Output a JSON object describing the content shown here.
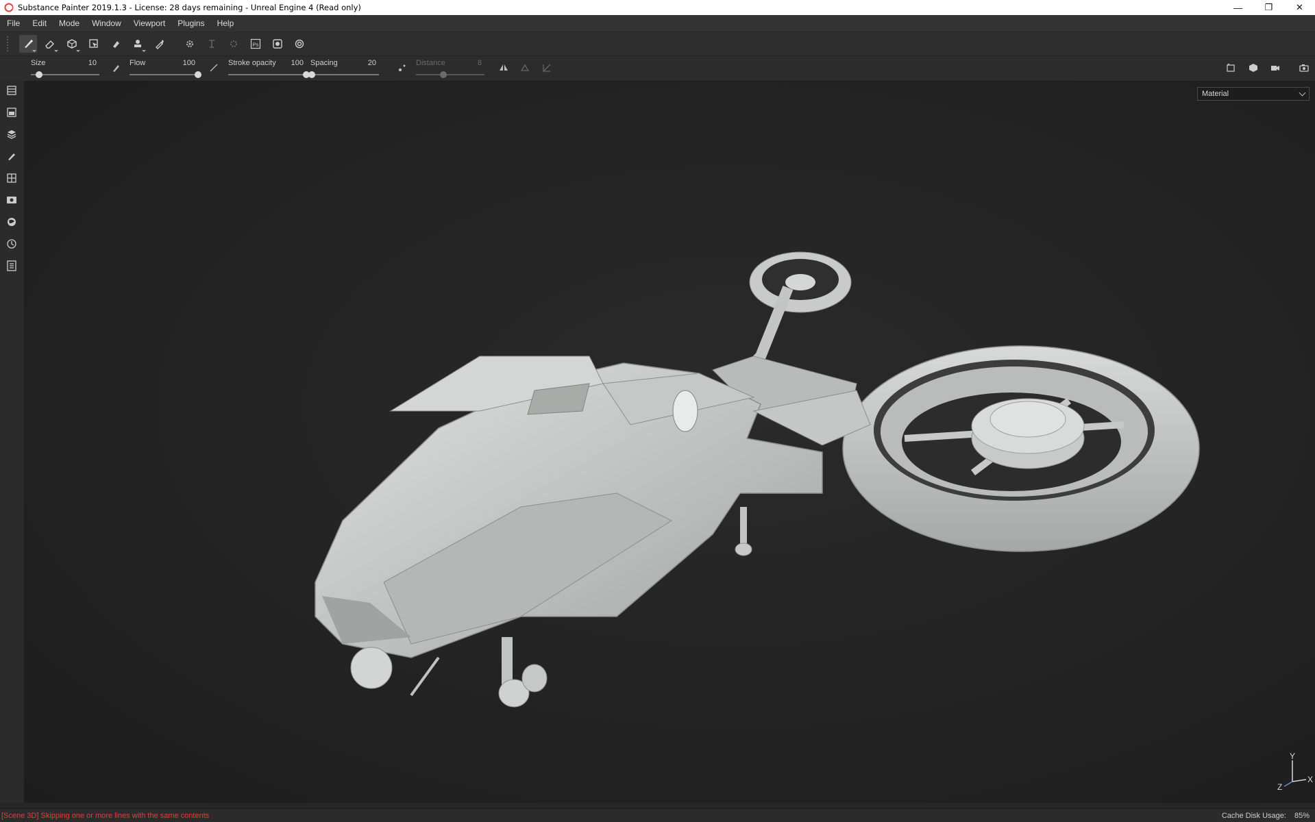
{
  "window": {
    "title": "Substance Painter 2019.1.3 - License: 28 days remaining - Unreal Engine 4 (Read only)",
    "controls": {
      "minimize": "—",
      "restore": "❐",
      "close": "✕"
    }
  },
  "menubar": {
    "items": [
      "File",
      "Edit",
      "Mode",
      "Window",
      "Viewport",
      "Plugins",
      "Help"
    ]
  },
  "toolstrip": {
    "tools": [
      "paint-brush-icon",
      "eraser-icon",
      "projection-icon",
      "polygon-fill-icon",
      "smudge-icon",
      "clone-icon",
      "color-picker-icon",
      "bake-icon",
      "send-to-icon",
      "geometry-icon",
      "photoshop-export-icon",
      "export-textures-icon",
      "settings-icon"
    ],
    "photoshop_label": "Ps"
  },
  "properties": {
    "size": {
      "label": "Size",
      "value": "10",
      "level": 0.12
    },
    "flow": {
      "label": "Flow",
      "value": "100",
      "level": 1.0
    },
    "stroke_opacity": {
      "label": "Stroke opacity",
      "value": "100",
      "level": 1.0
    },
    "spacing": {
      "label": "Spacing",
      "value": "20",
      "level": 0.02
    },
    "distance": {
      "label": "Distance",
      "value": "8",
      "level": 0.4
    }
  },
  "sidebar": {
    "items": [
      "layers-panel-icon",
      "texture-set-list-icon",
      "texture-set-settings-icon",
      "brush-settings-icon",
      "display-settings-icon",
      "viewer-settings-icon",
      "shelf-icon",
      "history-icon",
      "log-icon"
    ]
  },
  "viewport": {
    "mode_select": "Material",
    "axes": {
      "y": "Y",
      "x": "X",
      "z": "Z"
    }
  },
  "status": {
    "message": "[Scene 3D] Skipping one or more lines with the same contents",
    "cache_label": "Cache Disk Usage:",
    "cache_value": "85%"
  },
  "colors": {
    "background": "#262626",
    "error_text": "#e0413a",
    "model": "#c9ccca"
  }
}
